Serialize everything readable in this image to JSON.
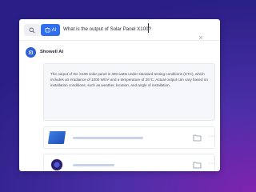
{
  "search": {
    "ai_label": "AI",
    "query": "What is the output of Solar Panel X100?"
  },
  "assistant": {
    "name": "Showell AI",
    "answer": "The output of the X100 solar panel is 400 watts under standard testing conditions (STC), which includes an irradiance of 1000 W/m² and a temperature of 25°C. Actual output can vary based on installation conditions, such as weather, location, and angle of installation."
  },
  "icons": {
    "search": "search-icon",
    "ai": "ai-sparkle-icon",
    "close": "close-icon",
    "avatar": "showell-logo-icon",
    "folder": "folder-icon",
    "more": "more-options-icon"
  },
  "colors": {
    "accent": "#2f6ef1",
    "background_start": "#2a1f86",
    "background_end": "#7f23b0"
  }
}
